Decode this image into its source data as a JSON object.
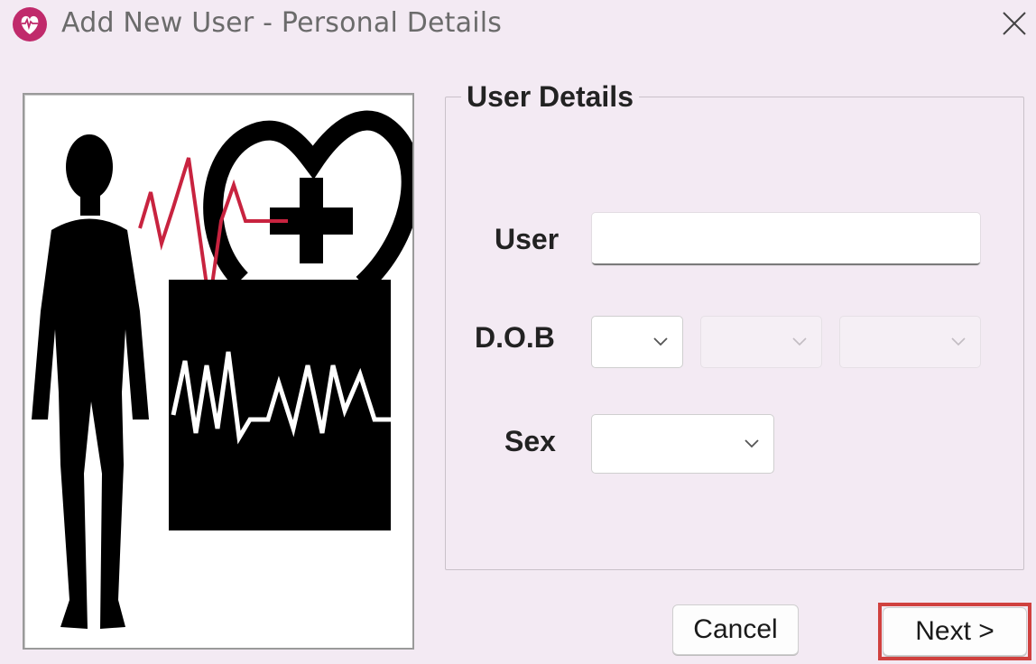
{
  "window": {
    "title": "Add New User - Personal Details",
    "icon": "heart-app-icon",
    "close_icon": "close-icon",
    "accent_color": "#c02a6b"
  },
  "groupbox": {
    "title": "User Details",
    "fields": {
      "user_label": "User",
      "user_value": "",
      "dob_label": "D.O.B",
      "dob_day_value": "",
      "dob_month_value": "",
      "dob_year_value": "",
      "sex_label": "Sex",
      "sex_value": ""
    }
  },
  "buttons": {
    "cancel_label": "Cancel",
    "next_label": "Next >",
    "highlight_color": "#d0413f"
  }
}
